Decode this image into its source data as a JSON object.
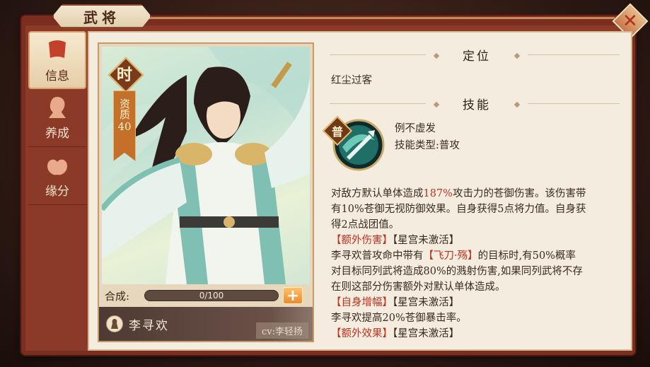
{
  "window": {
    "title": "武将",
    "close_icon": "close-icon"
  },
  "side_tabs": [
    {
      "label": "信息",
      "icon": "scroll-icon",
      "active": true
    },
    {
      "label": "养成",
      "icon": "profile-icon",
      "active": false
    },
    {
      "label": "缘分",
      "icon": "hands-icon",
      "active": false
    }
  ],
  "hero": {
    "grade": "时",
    "aptitude_label": "资质",
    "aptitude_value": "40",
    "synthesis_label": "合成:",
    "synthesis_progress": "0/100",
    "synthesis_fraction": 0,
    "name": "李寻欢",
    "cv": "cv:李轻扬"
  },
  "positioning": {
    "heading": "定位",
    "text": "红尘过客"
  },
  "skill": {
    "heading": "技能",
    "type_badge": "普",
    "name": "例不虚发",
    "type_line": "技能类型:普攻",
    "lines": [
      [
        "对敌方默认单体造成",
        "187%",
        "攻击力的苍御伤害。该伤害带"
      ],
      [
        "有10%苍御无视防御效果。自身获得5点将力值。自身获"
      ],
      [
        "得2点战团值。"
      ],
      [
        "【额外伤害】",
        "【星宫未激活】"
      ],
      [
        "李寻欢普攻命中带有",
        "【飞刀·殇】",
        "的目标时,有50%概率"
      ],
      [
        "对目标同列武将造成80%的溅射伤害,如果同列武将不存"
      ],
      [
        "在则这部分伤害额外对默认单体造成。"
      ],
      [
        "【自身增幅】",
        "【星宫未激活】"
      ],
      [
        "李寻欢提高20%苍御暴击率。"
      ],
      [
        "【额外效果】",
        "【星宫未激活】"
      ]
    ]
  },
  "colors": {
    "frame": "#7a2e1f",
    "parchment": "#f4ecdf",
    "highlight": "#c4301e",
    "text": "#3a2a20"
  }
}
